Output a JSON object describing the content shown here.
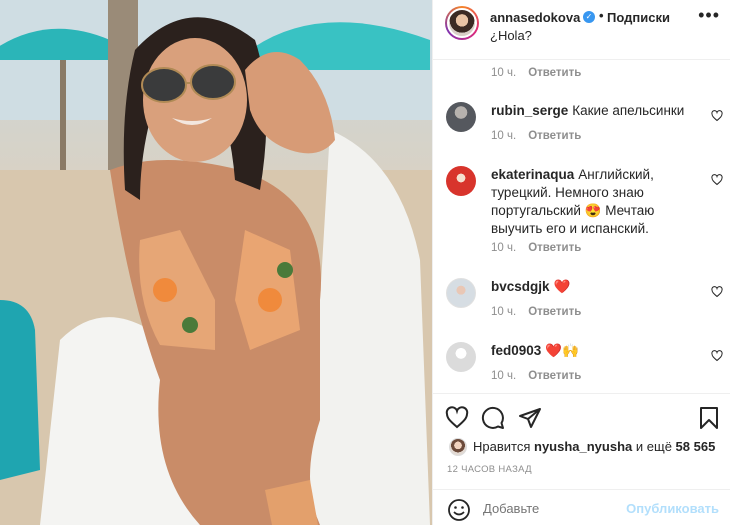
{
  "post": {
    "username": "annasedokova",
    "separator": "•",
    "follow_status": "Подписки",
    "caption": "¿Hola?"
  },
  "reply_label": "Ответить",
  "first_meta_time": "10 ч.",
  "comments": [
    {
      "username": "rubin_serge",
      "text": "Какие апельсинки",
      "time": "10 ч.",
      "avatar_color": "#7a7d85"
    },
    {
      "username": "ekaterinaqua",
      "text": "Английский, турецкий. Немного знаю португальский 😍 Мечтаю выучить его и испанский.",
      "time": "10 ч.",
      "avatar_color": "#d8342c"
    },
    {
      "username": "bvcsdgjk",
      "text": "❤️",
      "time": "10 ч.",
      "avatar_color": "#d6dde3"
    },
    {
      "username": "fed0903",
      "text": "❤️🙌",
      "time": "10 ч.",
      "avatar_color": "#dbdbdb"
    }
  ],
  "likes": {
    "prefix": "Нравится",
    "user": "nyusha_nyusha",
    "middle": "и ещё",
    "count": "58 565"
  },
  "timestamp": "12 ЧАСОВ НАЗАД",
  "add_comment": {
    "placeholder": "Добавьте",
    "publish_label": "Опубликовать"
  },
  "icons": {
    "like": "heart-icon",
    "comment": "comment-bubble-icon",
    "share": "paper-plane-icon",
    "save": "bookmark-icon",
    "options": "more-options-icon",
    "emoji": "smiley-icon"
  },
  "colors": {
    "accent_link": "#b2dffc",
    "verified": "#3897f0",
    "muted_text": "#8e8e8e",
    "heart_red": "#ed4956"
  }
}
